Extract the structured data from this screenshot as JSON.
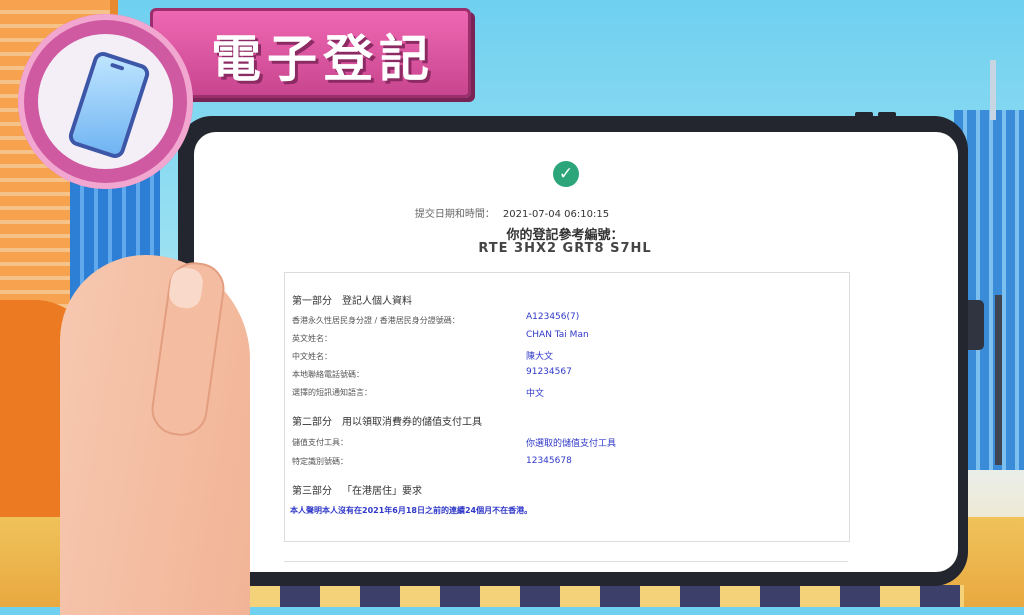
{
  "banner": {
    "title": "電子登記"
  },
  "icons": {
    "badge": "smartphone-icon",
    "status": "check-circle-icon"
  },
  "colors": {
    "banner": "#e05aa5",
    "success": "#2ca57a",
    "value_text": "#2f38c8"
  },
  "submission": {
    "datetime_label": "提交日期和時間：",
    "datetime_value": "2021-07-04 06:10:15",
    "reference_label": "你的登記參考編號：",
    "reference_code": "RTE 3HX2 GRT8 S7HL"
  },
  "part1": {
    "number": "第一部分",
    "title": "登記人個人資料",
    "rows": [
      {
        "label": "香港永久性居民身分證 / 香港居民身分證號碼：",
        "value": "A123456(7)"
      },
      {
        "label": "英文姓名：",
        "value": "CHAN Tai Man"
      },
      {
        "label": "中文姓名：",
        "value": "陳大文"
      },
      {
        "label": "本地聯絡電話號碼：",
        "value": "91234567"
      },
      {
        "label": "選擇的短訊通知語言：",
        "value": "中文"
      }
    ]
  },
  "part2": {
    "number": "第二部分",
    "title": "用以領取消費券的儲值支付工具",
    "rows": [
      {
        "label": "儲值支付工具：",
        "value": "你選取的儲值支付工具"
      },
      {
        "label": "特定識別號碼：",
        "value": "12345678"
      }
    ]
  },
  "part3": {
    "number": "第三部分",
    "title": "「在港居住」要求",
    "declaration": "本人聲明本人沒有在2021年6月18日之前的連續24個月不在香港。"
  }
}
